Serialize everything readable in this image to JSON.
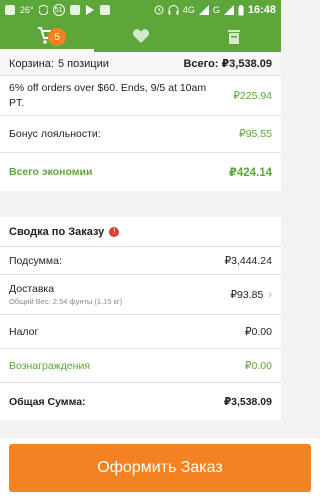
{
  "status_bar": {
    "temperature": "26°",
    "notif_count": "51",
    "network": "4G",
    "carrier": "G",
    "time": "16:48"
  },
  "tabs": [
    {
      "icon": "cart-icon",
      "badge": "5",
      "active": true
    },
    {
      "icon": "heart-icon",
      "active": false
    },
    {
      "icon": "trash-icon",
      "active": false
    }
  ],
  "cart_summary": {
    "label": "Корзина:",
    "count_text": "5 позиции",
    "total_label": "Всего:",
    "total_value": "₽3,538.09"
  },
  "discounts": [
    {
      "label": "6% off orders over $60. Ends, 9/5 at 10am PT.",
      "value": "₽225.94"
    },
    {
      "label": "Бонус лояльности:",
      "value": "₽95.55"
    }
  ],
  "savings": {
    "label": "Всего экономии",
    "value": "₽424.14"
  },
  "order_summary": {
    "title": "Сводка по Заказу",
    "subtotal_label": "Подсумма:",
    "subtotal_value": "₽3,444.24",
    "shipping_label": "Доставка",
    "shipping_sub": "Общий Вес: 2.54 фунты (1.15 кг)",
    "shipping_value": "₽93.85",
    "tax_label": "Налог",
    "tax_value": "₽0.00",
    "rewards_label": "Вознаграждения",
    "rewards_value": "₽0.00",
    "grand_label": "Общая Сумма:",
    "grand_value": "₽3,538.09"
  },
  "checkout": {
    "label": "Оформить Заказ"
  },
  "colors": {
    "brand_green": "#5da63a",
    "accent_orange": "#f58220",
    "alert_red": "#e53935"
  }
}
